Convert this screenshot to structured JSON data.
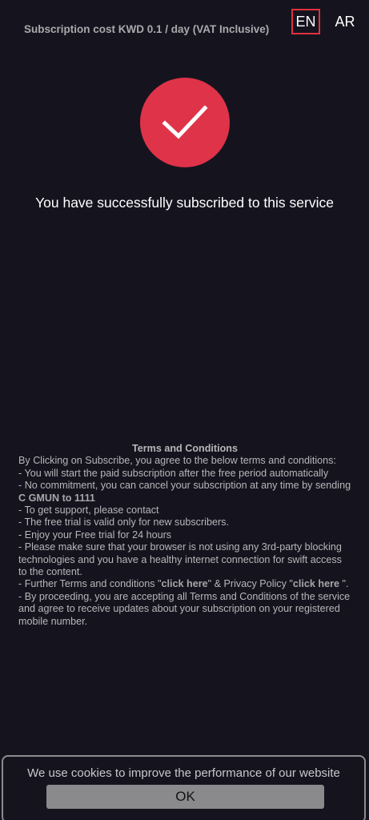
{
  "header": {
    "subscription_cost": "Subscription cost KWD 0.1 / day (VAT Inclusive)",
    "lang_en": "EN",
    "lang_ar": "AR",
    "active_language": "EN"
  },
  "main": {
    "status_icon": "checkmark-icon",
    "success_message": "You have successfully subscribed to this service"
  },
  "terms": {
    "title": "Terms and Conditions",
    "intro": "By Clicking on Subscribe, you agree to the below terms and conditions:",
    "item1": "-  You will start the paid subscription after the free period automatically",
    "item2_prefix": "- No commitment, you can cancel your subscription at any time by sending ",
    "item2_code": "C GMUN to 1111",
    "item3": "- To get support, please contact",
    "item4": "- The free trial is valid only for new subscribers.",
    "item5": "- Enjoy your Free trial for 24 hours",
    "item6": "- Please make sure that your browser is not using any 3rd-party blocking technologies and you have a healthy internet connection for swift access to the content.",
    "item7_prefix": "- Further Terms and conditions \"",
    "item7_link1": "click here",
    "item7_middle": "\" & Privacy Policy \"",
    "item7_link2": "click here",
    "item7_suffix": " \".",
    "item8": "- By proceeding, you are accepting all Terms and Conditions of the service and agree to receive updates about your subscription on your registered mobile number."
  },
  "cookie": {
    "message": "We use cookies to improve the performance of our website",
    "ok_label": "OK"
  },
  "colors": {
    "background": "#15141e",
    "accent": "#df3349",
    "active_border": "#e0313f"
  }
}
